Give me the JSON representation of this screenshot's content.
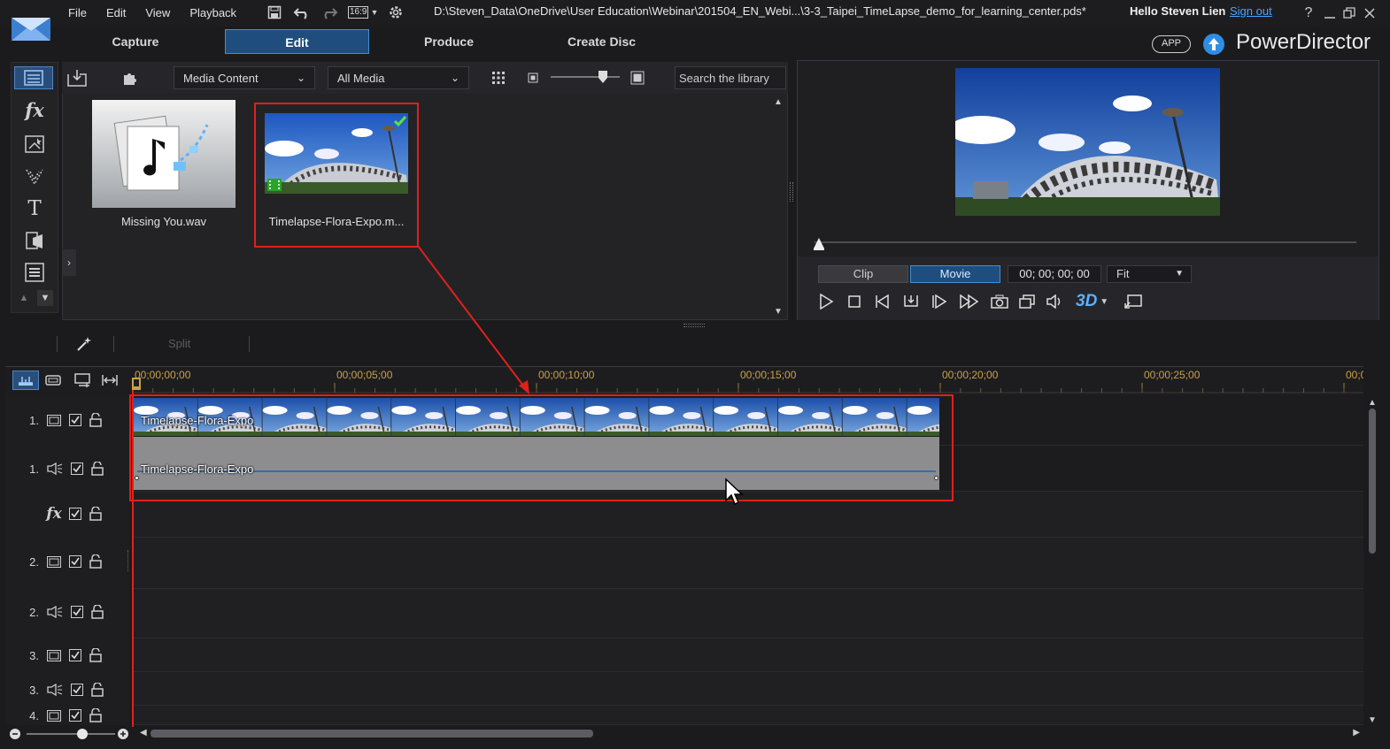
{
  "menu": [
    "File",
    "Edit",
    "View",
    "Playback"
  ],
  "toolbar": {
    "aspect": "16:9"
  },
  "window": {
    "title_path": "D:\\Steven_Data\\OneDrive\\User Education\\Webinar\\201504_EN_Webi...\\3-3_Taipei_TimeLapse_demo_for_learning_center.pds*",
    "greeting": "Hello Steven Lien",
    "signout": "Sign out",
    "brand": "PowerDirector",
    "app_badge": "APP"
  },
  "tabs": [
    "Capture",
    "Edit",
    "Produce",
    "Create Disc"
  ],
  "library": {
    "content_dropdown": "Media Content",
    "filter_dropdown": "All Media",
    "search_placeholder": "Search the library",
    "items": [
      {
        "label": "Missing You.wav"
      },
      {
        "label": "Timelapse-Flora-Expo.m..."
      }
    ]
  },
  "preview": {
    "clip_label": "Clip",
    "movie_label": "Movie",
    "timecode": "00; 00; 00; 00",
    "fit": "Fit",
    "threed": "3D"
  },
  "tools": {
    "split": "Split"
  },
  "timeline": {
    "ruler": [
      "00;00;00;00",
      "00;00;05;00",
      "00;00;10;00",
      "00;00;15;00",
      "00;00;20;00",
      "00;00;25;00",
      "00;0("
    ],
    "tracks": [
      "1.",
      "1.",
      "",
      "2.",
      "2.",
      "3.",
      "3.",
      "4."
    ],
    "clip_video_label": "Timelapse-Flora-Expo",
    "clip_audio_label": "Timelapse-Flora-Expo"
  },
  "colors": {
    "accent": "#3f8fd6",
    "highlight": "#e0201a",
    "timecode": "#c8a14a"
  }
}
